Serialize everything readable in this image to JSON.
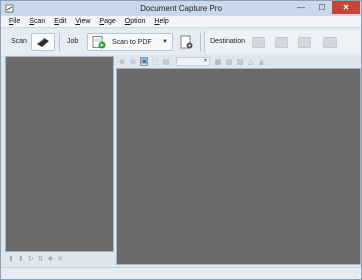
{
  "window": {
    "title": "Document Capture Pro",
    "minimize": "—",
    "maximize": "☐",
    "close": "✕"
  },
  "menu": [
    {
      "label": "File",
      "u": "F",
      "rest": "ile"
    },
    {
      "label": "Scan",
      "u": "S",
      "rest": "can"
    },
    {
      "label": "Edit",
      "u": "E",
      "rest": "dit"
    },
    {
      "label": "View",
      "u": "V",
      "rest": "iew"
    },
    {
      "label": "Page",
      "u": "P",
      "rest": "age"
    },
    {
      "label": "Option",
      "u": "O",
      "rest": "ption"
    },
    {
      "label": "Help",
      "u": "H",
      "rest": "elp"
    }
  ],
  "toolbar": {
    "scan_label": "Scan",
    "job_label": "Job",
    "job_selected": "Scan to PDF",
    "destination_label": "Destination"
  },
  "left_toolbar_icons": [
    "up-arrow",
    "down-arrow",
    "rotate",
    "sort",
    "add",
    "delete"
  ],
  "right_toolbar_icons": [
    "zoom-in",
    "zoom-out",
    "fit-page",
    "fit-width",
    "actual-size",
    "page-tools"
  ],
  "colors": {
    "pane_background": "#6a6a6a",
    "title_bar": "#c9d8ea",
    "close_button": "#c8433a"
  }
}
